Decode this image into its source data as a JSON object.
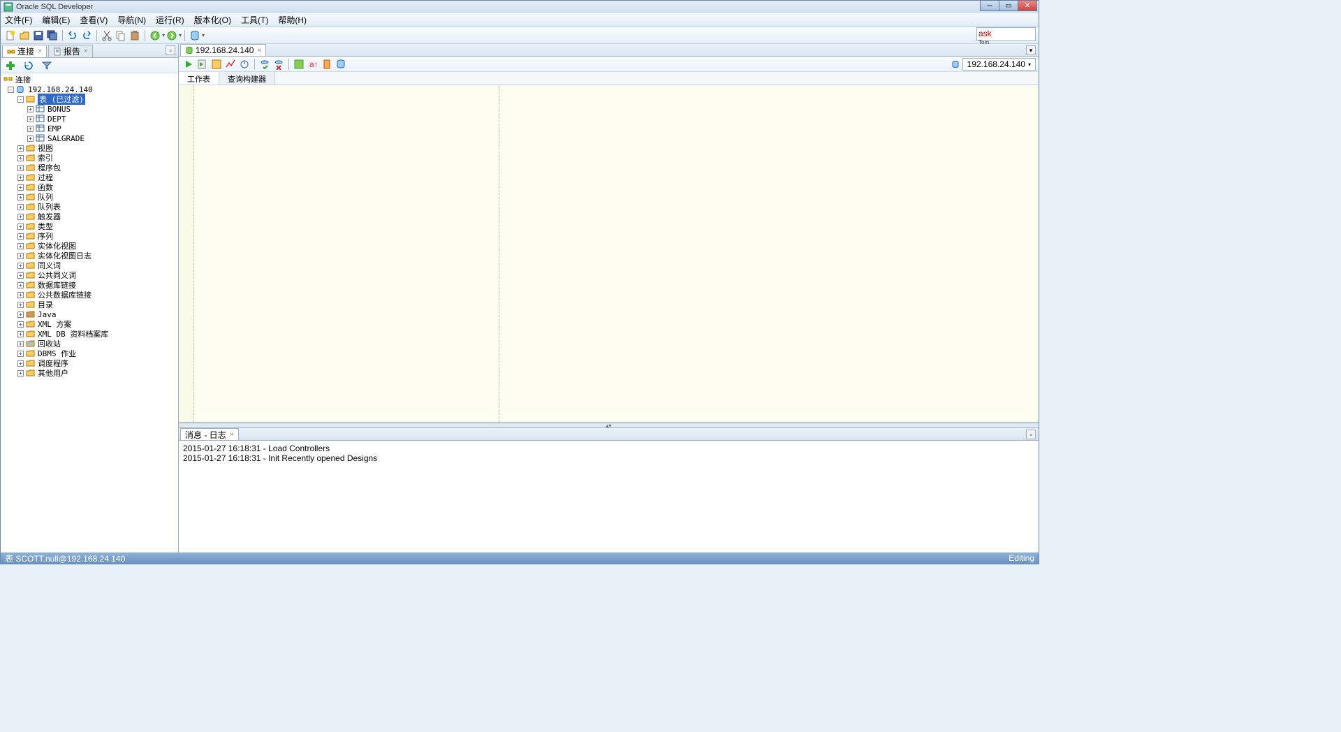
{
  "title": "Oracle SQL Developer",
  "menu": [
    "文件(F)",
    "编辑(E)",
    "查看(V)",
    "导航(N)",
    "运行(R)",
    "版本化(O)",
    "工具(T)",
    "帮助(H)"
  ],
  "left_tabs": [
    {
      "label": "连接",
      "active": true
    },
    {
      "label": "报告",
      "active": false
    }
  ],
  "tree_root_label": "连接",
  "connection": "192.168.24.140",
  "tables_label": "表 (已过滤)",
  "tables": [
    "BONUS",
    "DEPT",
    "EMP",
    "SALGRADE"
  ],
  "folders": [
    "视图",
    "索引",
    "程序包",
    "过程",
    "函数",
    "队列",
    "队列表",
    "触发器",
    "类型",
    "序列",
    "实体化视图",
    "实体化视图日志",
    "同义词",
    "公共同义词",
    "数据库链接",
    "公共数据库链接",
    "目录",
    "Java",
    "XML 方案",
    "XML DB 资料档案库",
    "回收站",
    "DBMS 作业",
    "调度程序",
    "其他用户"
  ],
  "right_tab": "192.168.24.140",
  "subtabs": [
    "工作表",
    "查询构建器"
  ],
  "db_selector": "192.168.24.140",
  "log_tab": "消息 - 日志",
  "log_lines": [
    "2015-01-27 16:18:31 - Load Controllers",
    "2015-01-27 16:18:31 - Init Recently opened Designs"
  ],
  "status_left": "表 SCOTT.null@192.168.24.140",
  "status_right": "Editing",
  "ask_label": "ask"
}
